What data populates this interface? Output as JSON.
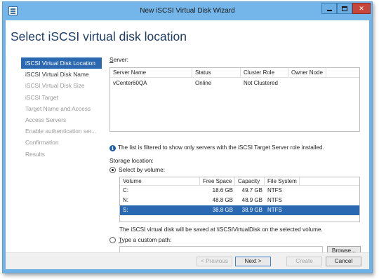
{
  "window": {
    "title": "New iSCSI Virtual Disk Wizard"
  },
  "page": {
    "title": "Select iSCSI virtual disk location"
  },
  "steps": [
    {
      "label": "iSCSI Virtual Disk Location",
      "state": "active"
    },
    {
      "label": "iSCSI Virtual Disk Name",
      "state": "done"
    },
    {
      "label": "iSCSI Virtual Disk Size",
      "state": "pending"
    },
    {
      "label": "iSCSI Target",
      "state": "pending"
    },
    {
      "label": "Target Name and Access",
      "state": "pending"
    },
    {
      "label": "Access Servers",
      "state": "pending"
    },
    {
      "label": "Enable authentication ser...",
      "state": "pending"
    },
    {
      "label": "Confirmation",
      "state": "pending"
    },
    {
      "label": "Results",
      "state": "pending"
    }
  ],
  "server": {
    "label": "Server:",
    "columns": [
      "Server Name",
      "Status",
      "Cluster Role",
      "Owner Node"
    ],
    "rows": [
      {
        "name": "vCenter60QA",
        "status": "Online",
        "role": "Not Clustered",
        "owner": ""
      }
    ]
  },
  "info_text": "The list is filtered to show only servers with the iSCSI Target Server role installed.",
  "storage": {
    "label": "Storage location:",
    "by_volume_label": "Select by volume:",
    "by_volume_checked": true,
    "columns": [
      "Volume",
      "Free Space",
      "Capacity",
      "File System"
    ],
    "volumes": [
      {
        "volume": "C:",
        "free": "18.6 GB",
        "capacity": "49.7 GB",
        "fs": "NTFS",
        "selected": false
      },
      {
        "volume": "N:",
        "free": "48.8 GB",
        "capacity": "48.9 GB",
        "fs": "NTFS",
        "selected": false
      },
      {
        "volume": "S:",
        "free": "38.8 GB",
        "capacity": "38.9 GB",
        "fs": "NTFS",
        "selected": true
      }
    ],
    "save_note": "The iSCSI virtual disk will be saved at \\iSCSIVirtualDisk on the selected volume.",
    "custom_path_label": "Type a custom path:",
    "custom_path_checked": false,
    "custom_path_value": "",
    "browse_label": "Browse..."
  },
  "buttons": {
    "previous": "< Previous",
    "next": "Next >",
    "create": "Create",
    "cancel": "Cancel"
  },
  "colors": {
    "accent": "#2a68b2",
    "title_text": "#1f3d64",
    "titlebar": "#74b6ea",
    "close": "#c7463c"
  }
}
